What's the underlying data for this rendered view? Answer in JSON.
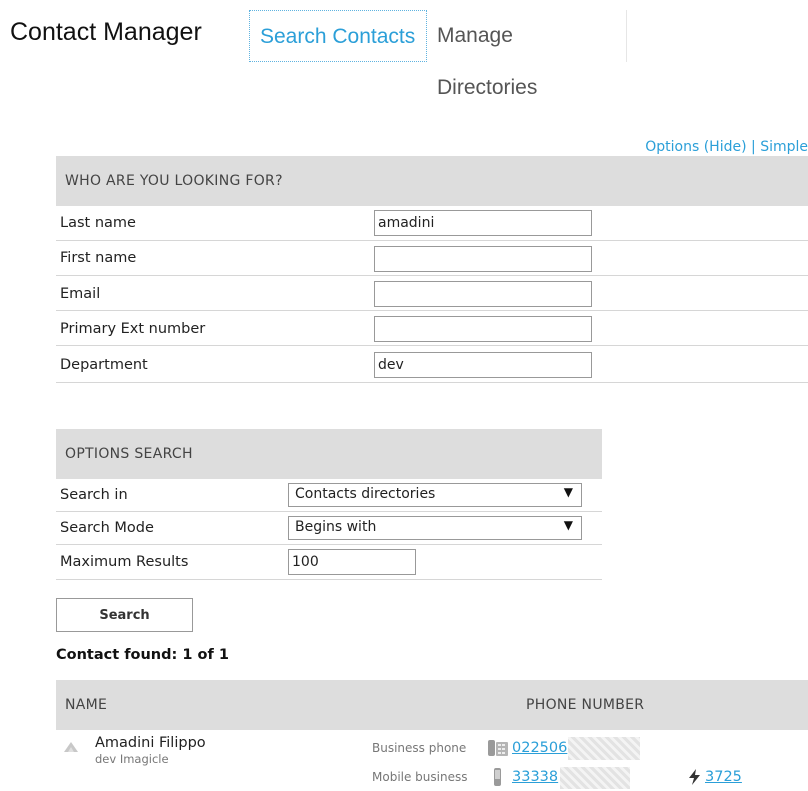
{
  "header": {
    "title": "Contact Manager",
    "tabs": [
      {
        "label": "Search Contacts",
        "active": true
      },
      {
        "label": "Manage Directories",
        "active": false
      }
    ]
  },
  "links": {
    "options": "Options (Hide)",
    "separator": "|",
    "simple": "Simple"
  },
  "who": {
    "heading": "WHO ARE YOU LOOKING FOR?",
    "fields": [
      {
        "label": "Last name",
        "value": "amadini"
      },
      {
        "label": "First name",
        "value": ""
      },
      {
        "label": "Email",
        "value": ""
      },
      {
        "label": "Primary Ext number",
        "value": ""
      },
      {
        "label": "Department",
        "value": "dev"
      }
    ]
  },
  "options": {
    "heading": "OPTIONS SEARCH",
    "search_in": {
      "label": "Search in",
      "value": "Contacts directories"
    },
    "search_mode": {
      "label": "Search Mode",
      "value": "Begins with"
    },
    "max_results": {
      "label": "Maximum Results",
      "value": "100"
    },
    "arrow": "▼"
  },
  "search_button": "Search",
  "found_text": "Contact found: 1 of 1",
  "results": {
    "col_name": "NAME",
    "col_phone": "PHONE NUMBER",
    "contact": {
      "name": "Amadini Filippo",
      "subtitle": "dev Imagicle",
      "business_label": "Business phone",
      "business_number": "022506",
      "mobile_label": "Mobile business",
      "mobile_number": "33338",
      "extra_number": "3725"
    }
  },
  "icons": {
    "person": "person-icon",
    "desk_phone": "desk-phone-icon",
    "mobile_phone": "mobile-phone-icon",
    "flash": "flash-icon"
  },
  "colors": {
    "accent": "#2b9fd8",
    "section_bg": "#dddddd"
  }
}
